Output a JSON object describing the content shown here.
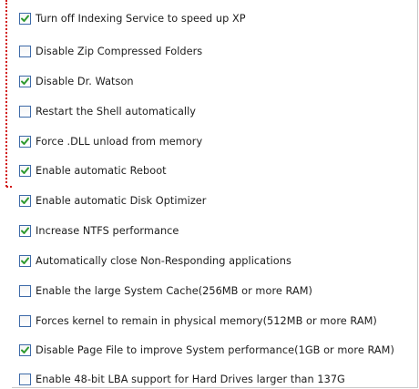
{
  "options": [
    {
      "label": "Turn off Indexing Service to speed up XP",
      "checked": true
    },
    {
      "label": "Disable Zip Compressed Folders",
      "checked": false
    },
    {
      "label": "Disable Dr. Watson",
      "checked": true
    },
    {
      "label": "Restart the Shell automatically",
      "checked": false
    },
    {
      "label": "Force .DLL unload from memory",
      "checked": true
    },
    {
      "label": "Enable automatic Reboot",
      "checked": true
    },
    {
      "label": "Enable automatic Disk Optimizer",
      "checked": true
    },
    {
      "label": "Increase NTFS performance",
      "checked": true
    },
    {
      "label": "Automatically close Non-Responding applications",
      "checked": true
    },
    {
      "label": "Enable the large System Cache(256MB or more RAM)",
      "checked": false
    },
    {
      "label": "Forces kernel to remain in physical memory(512MB or more RAM)",
      "checked": false
    },
    {
      "label": "Disable Page File to improve System performance(1GB or more RAM)",
      "checked": true
    },
    {
      "label": "Enable 48-bit LBA support for Hard Drives larger than 137G",
      "checked": false
    }
  ],
  "colors": {
    "check": "#2f9a2f",
    "annotation": "#d21a1a"
  }
}
